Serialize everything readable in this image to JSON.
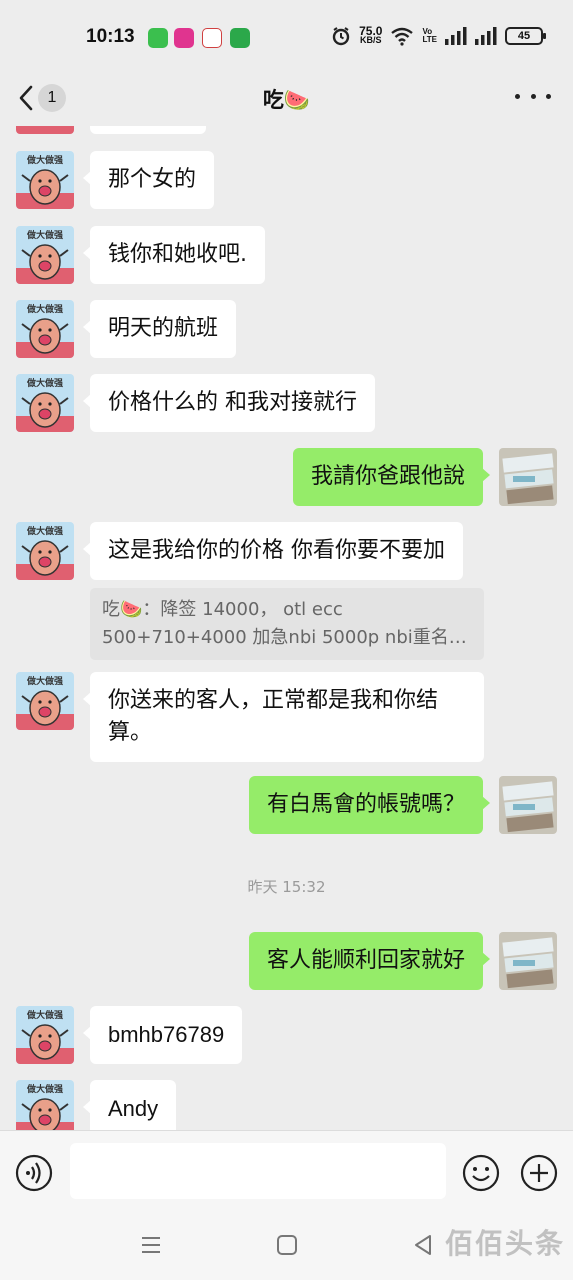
{
  "status_bar": {
    "time": "10:13",
    "net_speed_value": "75.0",
    "net_speed_unit": "KB/S",
    "volte_top": "Vo",
    "volte_bottom": "LTE",
    "battery": "45"
  },
  "nav": {
    "back_count": "1",
    "title": "吃🍉"
  },
  "messages": [
    {
      "side": "left",
      "text": "那个女的"
    },
    {
      "side": "left",
      "text": "钱你和她收吧."
    },
    {
      "side": "left",
      "text": "明天的航班"
    },
    {
      "side": "left",
      "text": "价格什么的 和我对接就行"
    },
    {
      "side": "right",
      "text": "我請你爸跟他說"
    },
    {
      "side": "left",
      "text": "这是我给你的价格 你看你要不要加"
    },
    {
      "side": "left",
      "text": "你送来的客人，正常都是我和你结算。"
    },
    {
      "side": "right",
      "text": "有白馬會的帳號嗎？"
    },
    {
      "side": "right",
      "text": "客人能顺利回家就好"
    },
    {
      "side": "left",
      "text": "bmhb76789"
    },
    {
      "side": "left",
      "text": "Andy"
    }
  ],
  "quote": {
    "line1": "吃🍉：降签 14000， otl ecc",
    "line2": "500+710+4000  加急nbi 5000p nbi重名…"
  },
  "timestamp": "昨天 15:32",
  "avatar_caption": "做大做强",
  "watermark": "佰佰头条",
  "colors": {
    "my_bubble": "#95ec69",
    "other_bubble": "#ffffff",
    "background": "#ededed"
  }
}
